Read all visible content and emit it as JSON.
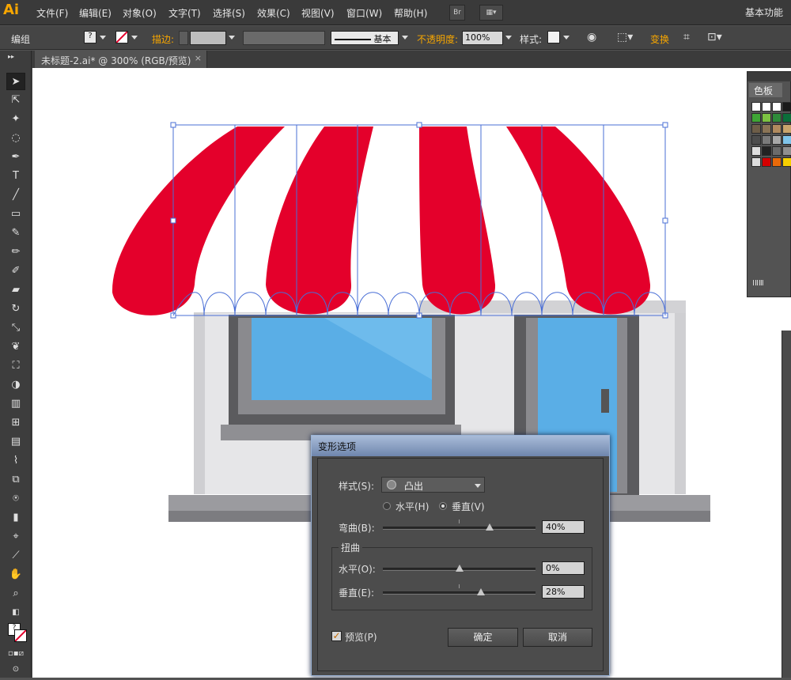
{
  "app": {
    "logo": "Ai",
    "workspace": "基本功能"
  },
  "menu": [
    "文件(F)",
    "编辑(E)",
    "对象(O)",
    "文字(T)",
    "选择(S)",
    "效果(C)",
    "视图(V)",
    "窗口(W)",
    "帮助(H)"
  ],
  "menu_buttons": {
    "bridge": "Br"
  },
  "control": {
    "selection": "编组",
    "stroke_label": "描边:",
    "brush": "基本",
    "opacity_label": "不透明度:",
    "opacity": "100%",
    "style_label": "样式:",
    "transform_label": "变换"
  },
  "document": {
    "tab": "未标题-2.ai* @ 300% (RGB/预览)",
    "close": "×"
  },
  "swatches_panel": {
    "title": "色板",
    "footer": "ⅠⅡⅢ"
  },
  "colors": {
    "stripe_red": "#e4002b",
    "accent_orange": "#f7a600",
    "selection_blue": "#4a6fd6"
  },
  "dialog": {
    "title": "变形选项",
    "style_label": "样式(S):",
    "style_value": "凸出",
    "horizontal": "水平(H)",
    "vertical": "垂直(V)",
    "orientation": "vertical",
    "bend_label": "弯曲(B):",
    "bend_value": "40%",
    "bend": 0.4,
    "distort_group": "扭曲",
    "dist_h_label": "水平(O):",
    "dist_h_value": "0%",
    "dist_h": 0.0,
    "dist_v_label": "垂直(E):",
    "dist_v_value": "28%",
    "dist_v": 0.28,
    "preview_label": "预览(P)",
    "preview_checked": true,
    "ok": "确定",
    "cancel": "取消"
  }
}
